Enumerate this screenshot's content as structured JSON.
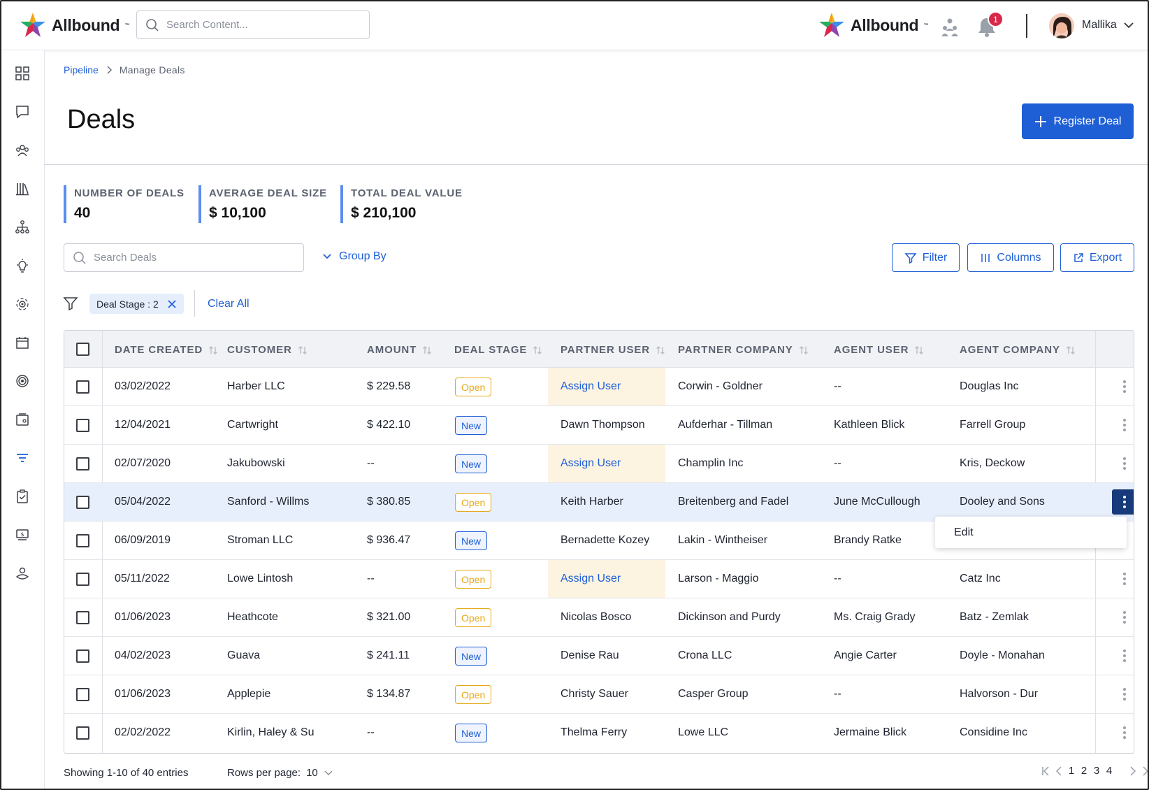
{
  "topbar": {
    "brand": "Allbound",
    "search_placeholder": "Search Content...",
    "partner_brand": "Allbound",
    "notification_count": "1",
    "user_name": "Mallika"
  },
  "breadcrumb": {
    "parent": "Pipeline",
    "current": "Manage Deals"
  },
  "page": {
    "title": "Deals",
    "register_label": "Register Deal"
  },
  "stats": [
    {
      "label": "NUMBER OF DEALS",
      "value": "40"
    },
    {
      "label": "AVERAGE DEAL SIZE",
      "value": "$ 10,100"
    },
    {
      "label": "TOTAL DEAL VALUE",
      "value": "$ 210,100"
    }
  ],
  "toolbar": {
    "search_placeholder": "Search Deals",
    "group_by": "Group By",
    "filter": "Filter",
    "columns": "Columns",
    "export": "Export"
  },
  "filters": {
    "chip": "Deal Stage : 2",
    "clear_all": "Clear All"
  },
  "table": {
    "headers": [
      "DATE CREATED",
      "CUSTOMER",
      "AMOUNT",
      "DEAL STAGE",
      "PARTNER USER",
      "PARTNER COMPANY",
      "AGENT USER",
      "AGENT COMPANY"
    ],
    "rows": [
      {
        "date": "03/02/2022",
        "customer": "Harber LLC",
        "amount": "$ 229.58",
        "stage": "Open",
        "partner_user": "Assign User",
        "partner_company": "Corwin - Goldner",
        "agent_user": "--",
        "agent_company": "Douglas Inc"
      },
      {
        "date": "12/04/2021",
        "customer": "Cartwright",
        "amount": "$ 422.10",
        "stage": "New",
        "partner_user": "Dawn Thompson",
        "partner_company": "Aufderhar - Tillman",
        "agent_user": "Kathleen Blick",
        "agent_company": "Farrell Group"
      },
      {
        "date": "02/07/2020",
        "customer": "Jakubowski",
        "amount": "--",
        "stage": "New",
        "partner_user": "Assign User",
        "partner_company": "Champlin Inc",
        "agent_user": "--",
        "agent_company": "Kris, Deckow"
      },
      {
        "date": "05/04/2022",
        "customer": "Sanford - Willms",
        "amount": "$ 380.85",
        "stage": "Open",
        "partner_user": "Keith Harber",
        "partner_company": "Breitenberg and Fadel",
        "agent_user": "June McCullough",
        "agent_company": "Dooley and Sons"
      },
      {
        "date": "06/09/2019",
        "customer": "Stroman LLC",
        "amount": "$ 936.47",
        "stage": "New",
        "partner_user": "Bernadette Kozey",
        "partner_company": "Lakin - Wintheiser",
        "agent_user": "Brandy Ratke",
        "agent_company": ""
      },
      {
        "date": "05/11/2022",
        "customer": "Lowe Lintosh",
        "amount": "--",
        "stage": "Open",
        "partner_user": "Assign User",
        "partner_company": "Larson - Maggio",
        "agent_user": "--",
        "agent_company": "Catz Inc"
      },
      {
        "date": "01/06/2023",
        "customer": "Heathcote",
        "amount": "$ 321.00",
        "stage": "Open",
        "partner_user": "Nicolas Bosco",
        "partner_company": "Dickinson and Purdy",
        "agent_user": "Ms. Craig Grady",
        "agent_company": "Batz - Zemlak"
      },
      {
        "date": "04/02/2023",
        "customer": "Guava",
        "amount": "$ 241.11",
        "stage": "New",
        "partner_user": "Denise Rau",
        "partner_company": "Crona LLC",
        "agent_user": "Angie Carter",
        "agent_company": "Doyle - Monahan"
      },
      {
        "date": "01/06/2023",
        "customer": "Applepie",
        "amount": "$ 134.87",
        "stage": "Open",
        "partner_user": "Christy Sauer",
        "partner_company": "Casper Group",
        "agent_user": "--",
        "agent_company": "Halvorson - Dur"
      },
      {
        "date": "02/02/2022",
        "customer": "Kirlin, Haley & Su",
        "amount": "--",
        "stage": "New",
        "partner_user": "Thelma Ferry",
        "partner_company": "Lowe LLC",
        "agent_user": "Jermaine Blick",
        "agent_company": "Considine Inc"
      }
    ],
    "row_menu": {
      "edit": "Edit"
    }
  },
  "footer": {
    "showing": "Showing 1-10 of 40 entries",
    "rows_per_page_label": "Rows per page:",
    "rows_per_page_value": "10",
    "pages": [
      "1",
      "2",
      "3",
      "4"
    ]
  },
  "colors": {
    "accent": "#1f5fd6",
    "open": "#e6a817",
    "highlight_row": "#e8effc",
    "assign_bg": "#fdf3e1"
  }
}
